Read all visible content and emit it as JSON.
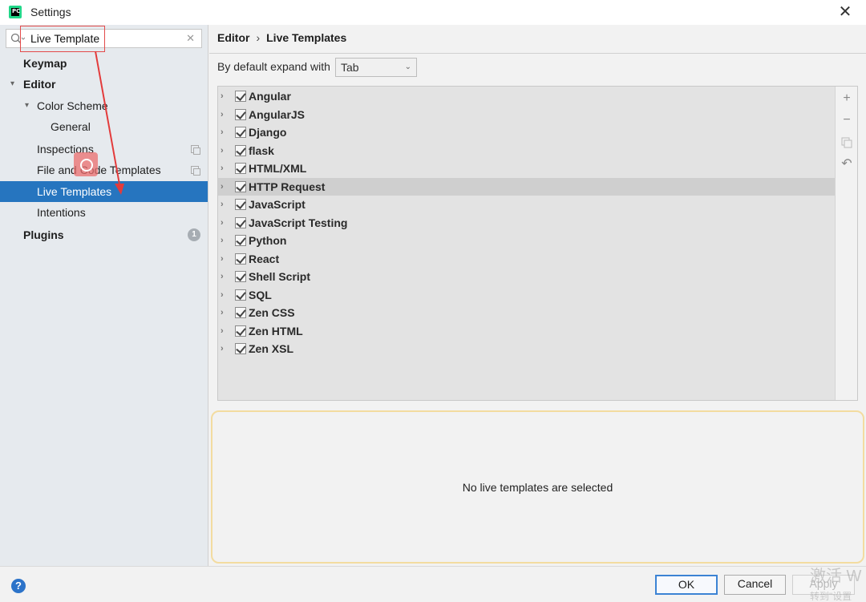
{
  "window": {
    "title": "Settings",
    "app_icon_text": "PC"
  },
  "search": {
    "value": "Live Template"
  },
  "sidebar": {
    "items": [
      {
        "label": "Keymap"
      },
      {
        "label": "Editor"
      },
      {
        "label": "Color Scheme"
      },
      {
        "label": "General"
      },
      {
        "label": "Inspections"
      },
      {
        "label": "File and Code Templates"
      },
      {
        "label": "Live Templates"
      },
      {
        "label": "Intentions"
      },
      {
        "label": "Plugins",
        "badge": "1"
      }
    ]
  },
  "breadcrumb": {
    "parent": "Editor",
    "separator": "›",
    "current": "Live Templates"
  },
  "expand": {
    "label": "By default expand with",
    "selected": "Tab"
  },
  "template_groups": [
    "Angular",
    "AngularJS",
    "Django",
    "flask",
    "HTML/XML",
    "HTTP Request",
    "JavaScript",
    "JavaScript Testing",
    "Python",
    "React",
    "Shell Script",
    "SQL",
    "Zen CSS",
    "Zen HTML",
    "Zen XSL"
  ],
  "toolbar": {
    "add": "+",
    "remove": "−",
    "undo": "↶"
  },
  "detail": {
    "empty_text": "No live templates are selected"
  },
  "buttons": {
    "help": "?",
    "ok": "OK",
    "cancel": "Cancel",
    "apply": "Apply"
  },
  "watermark": {
    "line1": "激活 W",
    "line2": "转到\"设置"
  },
  "colors": {
    "selection": "#2675bf",
    "annotation": "#e34a4a",
    "primary_button_border": "#3c83d4"
  }
}
